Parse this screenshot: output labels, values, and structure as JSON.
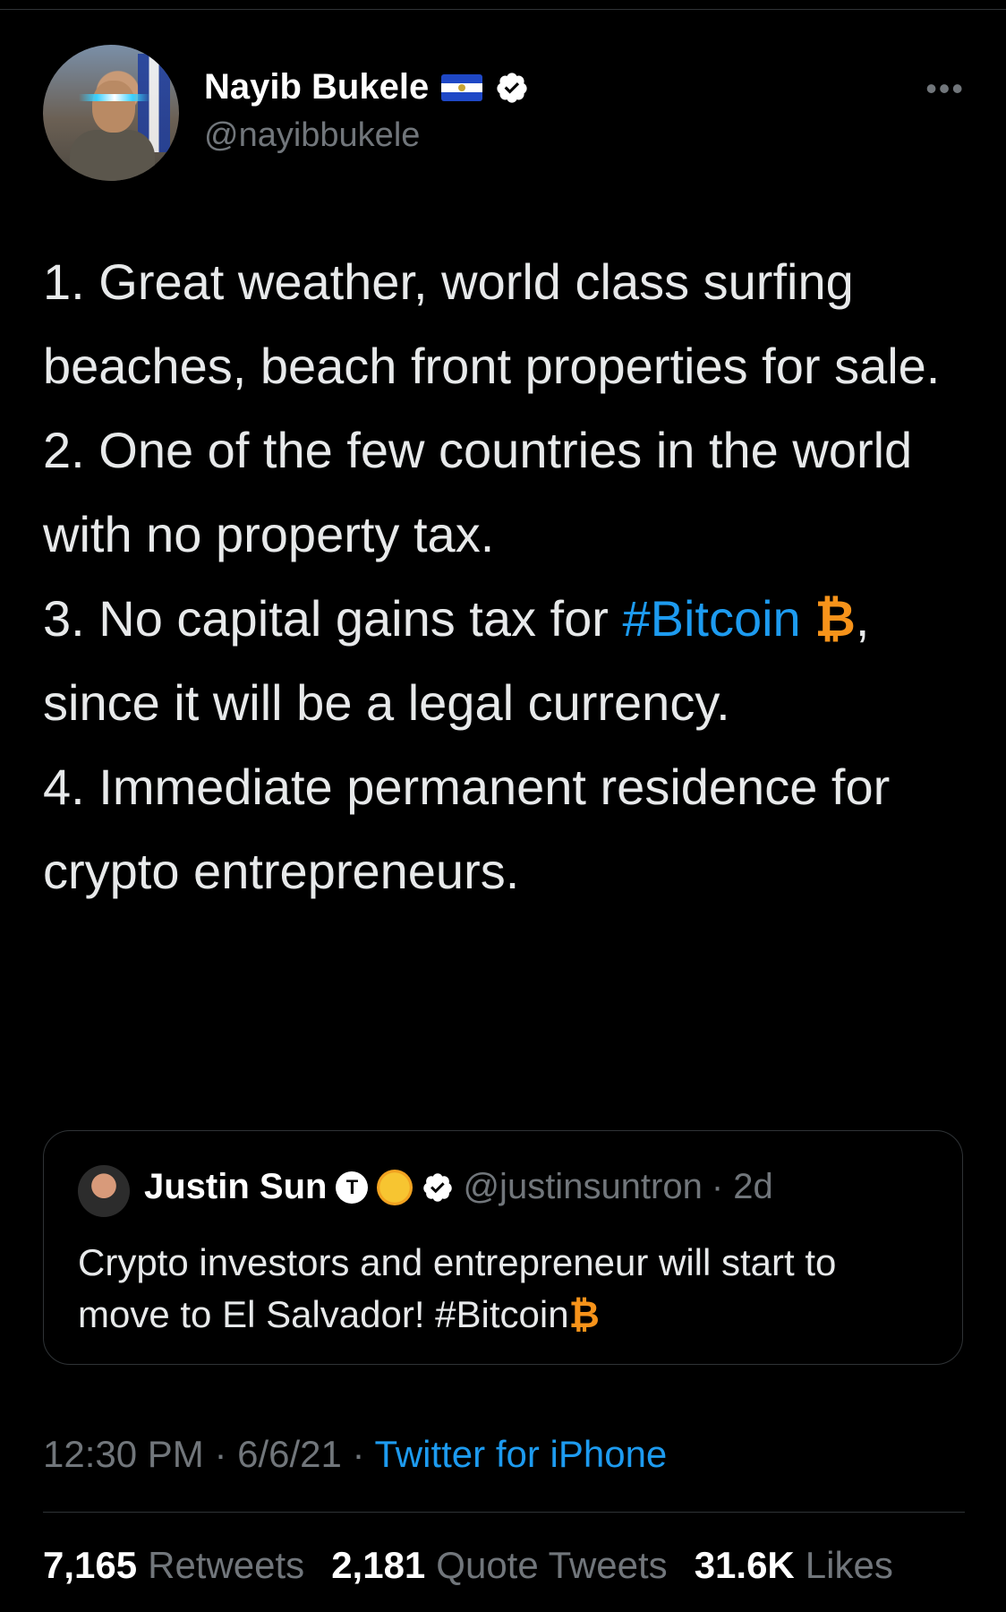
{
  "author": {
    "name": "Nayib Bukele",
    "handle": "@nayibbukele",
    "verified": true,
    "more_label": "•••"
  },
  "tweet": {
    "text_parts": [
      "1. Great weather, world class surfing beaches, beach front properties for sale.\n2. One of the few countries in the world with no property tax.\n3. No capital gains tax for ",
      "#Bitcoin",
      " ",
      "₿",
      ", since it will be a legal currency.\n4. Immediate permanent residence for crypto entrepreneurs."
    ]
  },
  "quoted_tweet": {
    "name": "Justin Sun",
    "tron_badge": "T",
    "handle": "@justinsuntron",
    "time": "· 2d",
    "text": "Crypto investors and entrepreneur will start to move to El Salvador! #Bitcoin",
    "btc_symbol": "₿"
  },
  "meta": {
    "time": "12:30 PM",
    "date": "6/6/21",
    "sep": " · ",
    "source": "Twitter for iPhone"
  },
  "stats": {
    "retweets": "7,165",
    "retweets_label": "Retweets",
    "quotes": "2,181",
    "quotes_label": "Quote Tweets",
    "likes": "31.6K",
    "likes_label": "Likes"
  },
  "colors": {
    "background": "#000000",
    "link": "#1d9bf0",
    "bitcoin": "#f7931a",
    "muted": "#71767b"
  }
}
